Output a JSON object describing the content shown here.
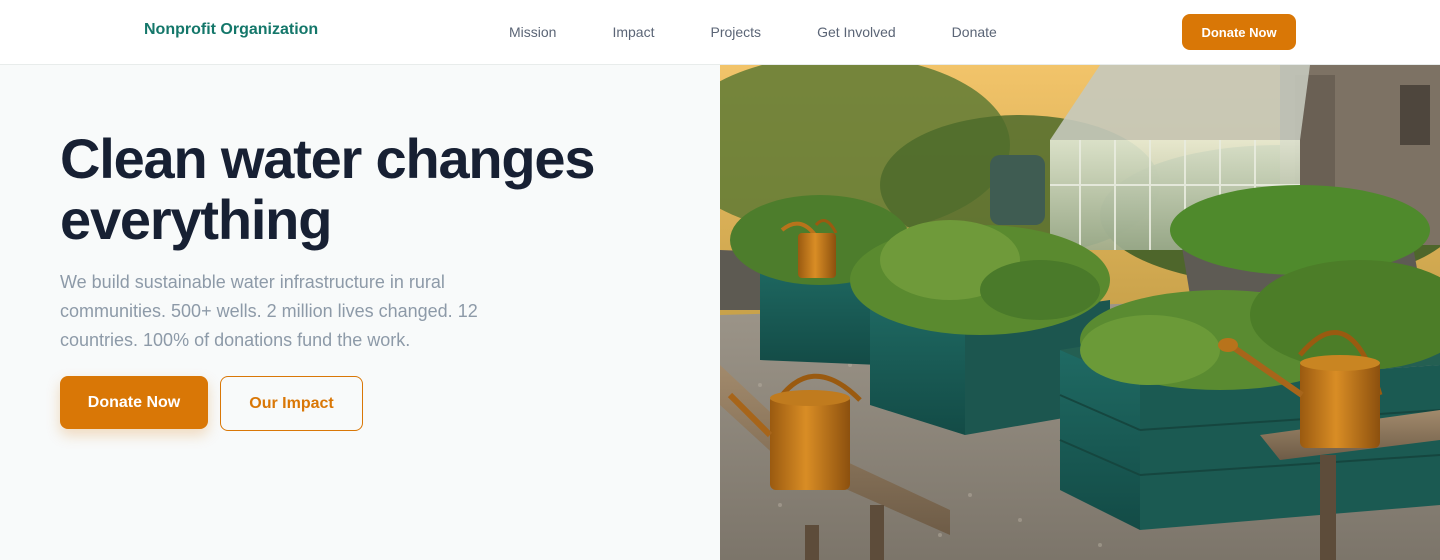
{
  "nav": {
    "brand": "Nonprofit Organization",
    "links": [
      {
        "label": "Mission"
      },
      {
        "label": "Impact"
      },
      {
        "label": "Projects"
      },
      {
        "label": "Get Involved"
      },
      {
        "label": "Donate"
      }
    ],
    "cta_label": "Donate Now"
  },
  "hero": {
    "headline_line1": "Clean water changes",
    "headline_line2": "everything",
    "subtext": "We build sustainable water infrastructure in rural communities. 500+ wells. 2 million lives changed. 12 countries. 100% of donations fund the work.",
    "primary_button": "Donate Now",
    "secondary_button": "Our Impact",
    "image_subject": "raised teal garden beds with copper watering cans and a greenhouse at golden hour"
  },
  "colors": {
    "brand": "#14776a",
    "accent": "#d97706",
    "heading": "#172033",
    "muted_text": "#8d9aa8",
    "hero_bg": "#f8fafa"
  }
}
